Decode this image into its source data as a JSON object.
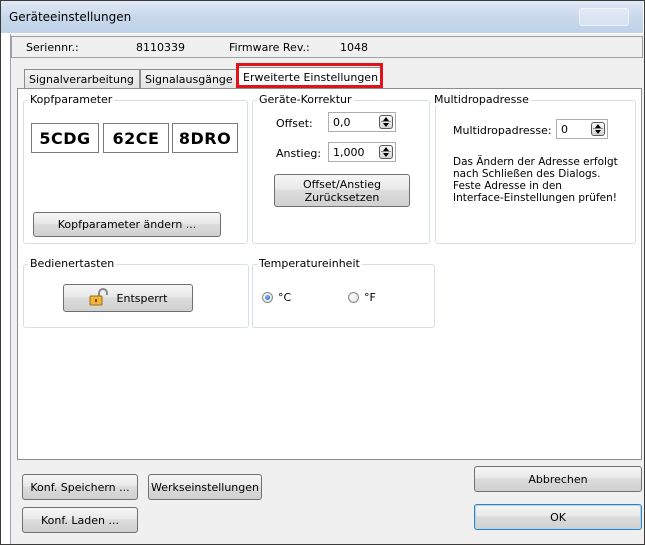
{
  "window": {
    "title": "Geräteeinstellungen"
  },
  "info": {
    "serial_label": "Seriennr.:",
    "serial_value": "8110339",
    "firmware_label": "Firmware Rev.:",
    "firmware_value": "1048"
  },
  "tabs": [
    {
      "label": "Signalverarbeitung"
    },
    {
      "label": "Signalausgänge"
    },
    {
      "label": "Erweiterte Einstellungen"
    }
  ],
  "kopf": {
    "title": "Kopfparameter",
    "codes": [
      "5CDG",
      "62CE",
      "8DRO"
    ],
    "button": "Kopfparameter ändern ..."
  },
  "korrektur": {
    "title": "Geräte-Korrektur",
    "offset_label": "Offset:",
    "offset_value": "0,0",
    "anstieg_label": "Anstieg:",
    "anstieg_value": "1,000",
    "reset_line1": "Offset/Anstieg",
    "reset_line2": "Zurücksetzen"
  },
  "multidrop": {
    "title": "Multidropadresse",
    "label": "Multidropadresse:",
    "value": "0",
    "note_1": "Das Ändern der Adresse erfolgt",
    "note_2": "nach Schließen des Dialogs.",
    "note_3": "Feste Adresse in den",
    "note_4": "Interface-Einstellungen prüfen!"
  },
  "bedien": {
    "title": "Bedienertasten",
    "button": "Entsperrt"
  },
  "temp": {
    "title": "Temperatureinheit",
    "celsius": "°C",
    "fahrenheit": "°F",
    "selected": "°C"
  },
  "footer": {
    "save": "Konf. Speichern ...",
    "factory": "Werkseinstellungen",
    "load": "Konf. Laden ...",
    "cancel": "Abbrechen",
    "ok": "OK"
  }
}
